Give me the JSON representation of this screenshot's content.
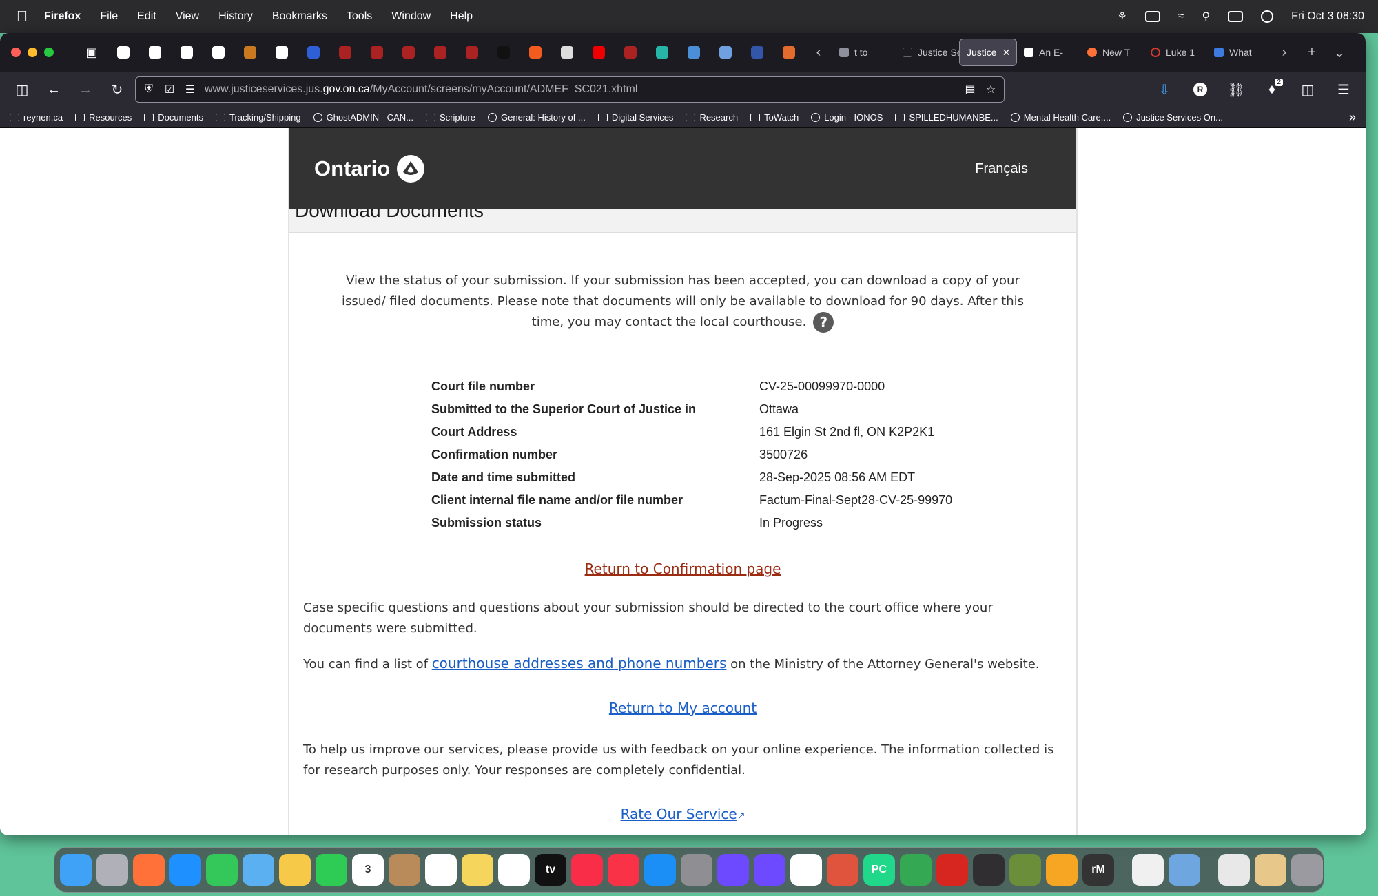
{
  "menubar": {
    "items": [
      "Firefox",
      "File",
      "Edit",
      "View",
      "History",
      "Bookmarks",
      "Tools",
      "Window",
      "Help"
    ],
    "datetime": "Fri Oct 3  08:30"
  },
  "tabs": [
    {
      "label": "t to",
      "color": "#8f8f9d"
    },
    {
      "label": "Justice Se",
      "color": "#1c1b22"
    },
    {
      "label": "Justice",
      "color": "#1c1b22",
      "active": true
    },
    {
      "label": "An E-",
      "color": "#ffffff"
    },
    {
      "label": "New T",
      "color": "#ff7139"
    },
    {
      "label": "Luke 1",
      "color": "#d63a2f"
    },
    {
      "label": "What",
      "color": "#3d7be0"
    }
  ],
  "pinned_tab_colors": [
    "#ffffff",
    "#ffffff",
    "#ffffff",
    "#ffffff",
    "#c97a20",
    "#ffffff",
    "#2f5fd6",
    "#a22",
    "#a22",
    "#a22",
    "#a22",
    "#a22",
    "#111",
    "#f25c1f",
    "#ddd",
    "#e00",
    "#a22",
    "#27b5a8",
    "#4a8fd8",
    "#6fa1e0",
    "#3355aa",
    "#e36c2c"
  ],
  "urlbar": {
    "prefix": "www.justiceservices.jus.",
    "domain": "gov.on.ca",
    "path": "/MyAccount/screens/myAccount/ADMEF_SC021.xhtml"
  },
  "bookmarks": [
    {
      "label": "reynen.ca",
      "icon": "folder"
    },
    {
      "label": "Resources",
      "icon": "folder"
    },
    {
      "label": "Documents",
      "icon": "folder"
    },
    {
      "label": "Tracking/Shipping",
      "icon": "folder"
    },
    {
      "label": "GhostADMIN - CAN...",
      "icon": "globe"
    },
    {
      "label": "Scripture",
      "icon": "folder"
    },
    {
      "label": "General: History of ...",
      "icon": "globe"
    },
    {
      "label": "Digital Services",
      "icon": "folder"
    },
    {
      "label": "Research",
      "icon": "folder"
    },
    {
      "label": "ToWatch",
      "icon": "folder"
    },
    {
      "label": "Login - IONOS",
      "icon": "globe"
    },
    {
      "label": "SPILLEDHUMANBE...",
      "icon": "folder"
    },
    {
      "label": "Mental Health Care,...",
      "icon": "globe"
    },
    {
      "label": "Justice Services On...",
      "icon": "globe"
    }
  ],
  "extension_badge": "2",
  "page": {
    "brand": "Ontario",
    "language_link": "Français",
    "section_title": "Download Documents",
    "intro_text": "View the status of your submission. If your submission has been accepted, you can download a copy of your issued/ filed documents. Please note that documents will only be available to download for 90 days. After this time, you may contact the local courthouse.",
    "help_glyph": "?",
    "details": [
      {
        "label": "Court file number",
        "value": "CV-25-00099970-0000"
      },
      {
        "label": "Submitted to the Superior Court of Justice in",
        "value": "Ottawa"
      },
      {
        "label": "Court Address",
        "value": "161 Elgin St 2nd fl, ON K2P2K1"
      },
      {
        "label": "Confirmation number",
        "value": "3500726"
      },
      {
        "label": "Date and time submitted",
        "value": "28-Sep-2025 08:56 AM EDT"
      },
      {
        "label": "Client internal file name and/or file number",
        "value": "Factum-Final-Sept28-CV-25-99970"
      },
      {
        "label": "Submission status",
        "value": "In Progress"
      }
    ],
    "return_confirmation": "Return to Confirmation page",
    "case_questions": "Case specific questions and questions about your submission should be directed to the court office where your documents were submitted.",
    "courthouse_prefix": "You can find a list of ",
    "courthouse_link": "courthouse addresses and phone numbers",
    "courthouse_suffix": " on the Ministry of the Attorney General's website.",
    "return_account": "Return to My account",
    "feedback_text": "To help us improve our services, please provide us with feedback on your online experience. The information collected is for research purposes only. Your responses are completely confidential.",
    "rate_link": "Rate Our Service"
  },
  "dock": {
    "apps": [
      {
        "name": "finder",
        "color": "#3fa2f7",
        "label": ""
      },
      {
        "name": "launchpad",
        "color": "#b0b0b8",
        "label": ""
      },
      {
        "name": "firefox",
        "color": "#ff7139",
        "label": ""
      },
      {
        "name": "safari",
        "color": "#1e90ff",
        "label": ""
      },
      {
        "name": "messages",
        "color": "#34c759",
        "label": ""
      },
      {
        "name": "maps",
        "color": "#5ab0f0",
        "label": ""
      },
      {
        "name": "photos",
        "color": "#f7c948",
        "label": ""
      },
      {
        "name": "facetime",
        "color": "#2ecc55",
        "label": ""
      },
      {
        "name": "calendar",
        "color": "#ffffff",
        "label": "3"
      },
      {
        "name": "contacts",
        "color": "#b98a5a",
        "label": ""
      },
      {
        "name": "reminders",
        "color": "#ffffff",
        "label": ""
      },
      {
        "name": "notes",
        "color": "#f6d55c",
        "label": ""
      },
      {
        "name": "freeform",
        "color": "#ffffff",
        "label": ""
      },
      {
        "name": "tv",
        "color": "#111111",
        "label": "tv"
      },
      {
        "name": "music",
        "color": "#fa2d48",
        "label": ""
      },
      {
        "name": "news",
        "color": "#fa3247",
        "label": ""
      },
      {
        "name": "app-store",
        "color": "#1b8ff5",
        "label": ""
      },
      {
        "name": "system-settings",
        "color": "#8e8e93",
        "label": ""
      },
      {
        "name": "proton-vpn",
        "color": "#6d4aff",
        "label": ""
      },
      {
        "name": "proton-mail",
        "color": "#6d4aff",
        "label": ""
      },
      {
        "name": "arc",
        "color": "#ffffff",
        "label": ""
      },
      {
        "name": "owl",
        "color": "#e0533d",
        "label": ""
      },
      {
        "name": "pycharm",
        "color": "#21d789",
        "label": "PC"
      },
      {
        "name": "chrome",
        "color": "#34a853",
        "label": ""
      },
      {
        "name": "acrobat",
        "color": "#d7261f",
        "label": ""
      },
      {
        "name": "obs",
        "color": "#302e31",
        "label": ""
      },
      {
        "name": "chess",
        "color": "#6b8e3a",
        "label": ""
      },
      {
        "name": "pages",
        "color": "#f6a623",
        "label": ""
      },
      {
        "name": "remarkable",
        "color": "#333333",
        "label": "rM"
      }
    ],
    "utilities": [
      {
        "name": "textedit",
        "color": "#f0f0f0",
        "label": ""
      },
      {
        "name": "preview",
        "color": "#6ea6e0",
        "label": ""
      }
    ],
    "stacks": [
      {
        "name": "documents-stack",
        "color": "#e8e8e8",
        "label": ""
      },
      {
        "name": "downloads-stack",
        "color": "#e8c88a",
        "label": ""
      },
      {
        "name": "trash",
        "color": "#9a9aa0",
        "label": ""
      }
    ]
  }
}
